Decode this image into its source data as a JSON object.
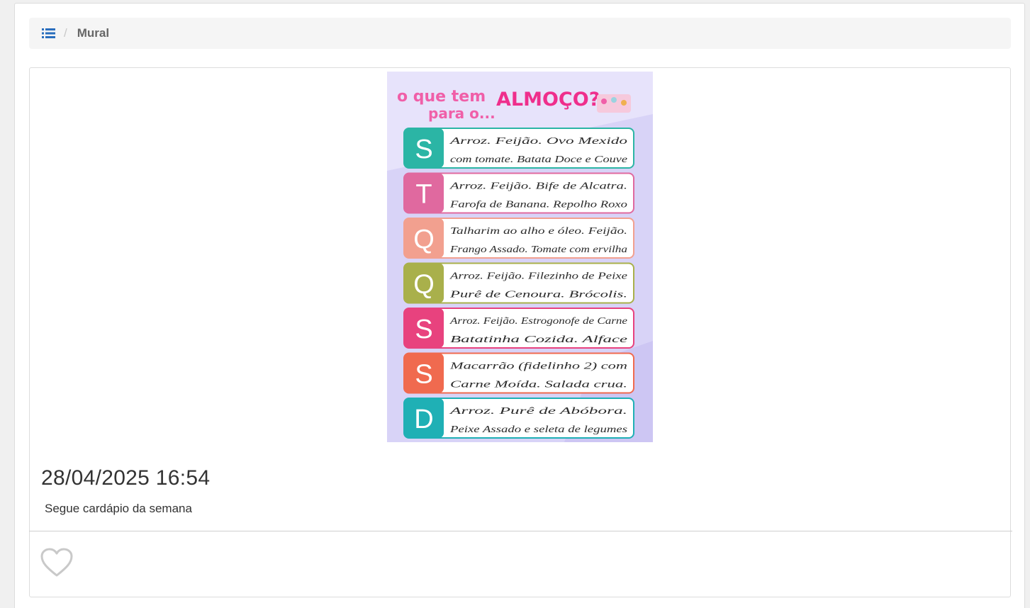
{
  "breadcrumb": {
    "icon": "list-icon",
    "current": "Mural"
  },
  "post": {
    "date": "28/04/2025 16:54",
    "text": "Segue cardápio da semana",
    "like_icon": "heart-outline-icon"
  },
  "menu_image": {
    "title_line1": "o que tem",
    "title_line2": "para o...",
    "title_main": "ALMOÇO?",
    "days": [
      {
        "letter": "S",
        "color": "#2bb5a5",
        "line1": "Arroz. Feijão. Ovo Mexido",
        "line2": "com tomate. Batata Doce e Couve"
      },
      {
        "letter": "T",
        "color": "#e0699f",
        "line1": "Arroz. Feijão. Bife de Alcatra.",
        "line2": "Farofa de Banana. Repolho Roxo"
      },
      {
        "letter": "Q",
        "color": "#f2a08f",
        "line1": "Talharim ao alho e óleo. Feijão.",
        "line2": "Frango Assado. Tomate com ervilha"
      },
      {
        "letter": "Q",
        "color": "#a9b04b",
        "line1": "Arroz. Feijão. Filezinho de Peixe",
        "line2": "Purê de Cenoura. Brócolis."
      },
      {
        "letter": "S",
        "color": "#e8427e",
        "line1": "Arroz. Feijão. Estrogonofe de Carne",
        "line2": "Batatinha Cozida. Alface"
      },
      {
        "letter": "S",
        "color": "#f06a4f",
        "line1": "Macarrão (fidelinho 2) com",
        "line2": "Carne Moída. Salada crua."
      },
      {
        "letter": "D",
        "color": "#1fb0b5",
        "line1": "Arroz. Purê de Abóbora.",
        "line2": "Peixe Assado e seleta de legumes"
      }
    ]
  }
}
